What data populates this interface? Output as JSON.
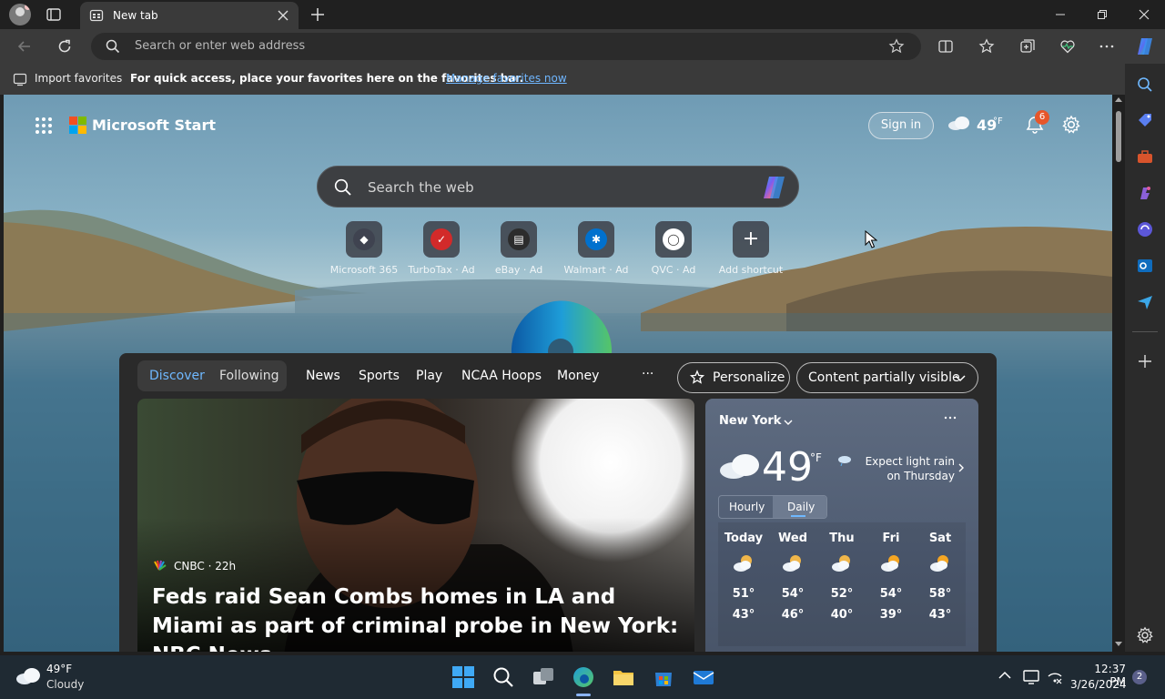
{
  "browser": {
    "tab_title": "New tab",
    "address_placeholder": "Search or enter web address"
  },
  "favorites_bar": {
    "import_label": "Import favorites",
    "message": "For quick access, place your favorites here on the favorites bar.",
    "link": "Manage favorites now"
  },
  "start": {
    "brand": "Microsoft Start",
    "sign_in": "Sign in",
    "header_temp": "49",
    "header_temp_unit": "°F",
    "notification_count": "6",
    "search_placeholder": "Search the web",
    "shortcuts": [
      {
        "label": "Microsoft 365",
        "icon": "m365-icon"
      },
      {
        "label": "TurboTax · Ad",
        "icon": "turbotax-icon"
      },
      {
        "label": "eBay · Ad",
        "icon": "ebay-icon"
      },
      {
        "label": "Walmart · Ad",
        "icon": "walmart-icon"
      },
      {
        "label": "QVC · Ad",
        "icon": "qvc-icon"
      },
      {
        "label": "Add shortcut",
        "icon": "plus-icon"
      }
    ]
  },
  "feed": {
    "tabs": [
      "Discover",
      "Following"
    ],
    "nav": [
      "News",
      "Sports",
      "Play",
      "NCAA Hoops",
      "Money"
    ],
    "more": "···",
    "personalize": "Personalize",
    "content_visibility": "Content partially visible",
    "article": {
      "source": "CNBC · 22h",
      "headline": "Feds raid Sean Combs homes in LA and Miami as part of criminal probe in New York: NBC News"
    }
  },
  "weather": {
    "location": "New York",
    "temp": "49",
    "unit": "°F",
    "forecast_text": "Expect light rain on Thursday",
    "toggle": [
      "Hourly",
      "Daily"
    ],
    "days": [
      {
        "day": "Today",
        "high": "51°",
        "low": "43°"
      },
      {
        "day": "Wed",
        "high": "54°",
        "low": "46°"
      },
      {
        "day": "Thu",
        "high": "52°",
        "low": "40°"
      },
      {
        "day": "Fri",
        "high": "54°",
        "low": "39°"
      },
      {
        "day": "Sat",
        "high": "58°",
        "low": "43°"
      }
    ]
  },
  "taskbar": {
    "weather_temp": "49°F",
    "weather_desc": "Cloudy",
    "time": "12:37 PM",
    "date": "3/26/2024",
    "notif_count": "2"
  }
}
